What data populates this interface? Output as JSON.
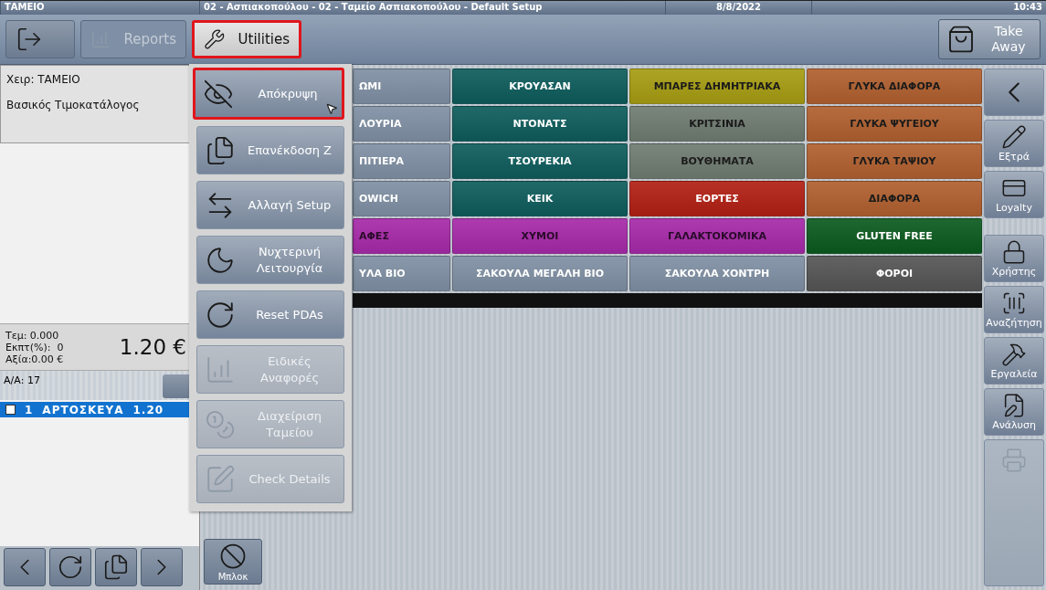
{
  "title_bar": {
    "app": "ΤΑΜΕΙΟ",
    "info": "02 - Ασπιακοπούλου - 02 - Ταμείο Ασπιακοπούλου - Default Setup",
    "date": "8/8/2022",
    "time": "10:43"
  },
  "toolbar": {
    "buttons": [
      {
        "kind": "exit",
        "disabled": false,
        "highlighted": false
      },
      {
        "kind": "reports",
        "label": "Reports",
        "disabled": true,
        "highlighted": false
      },
      {
        "kind": "utilities",
        "label": "Utilities",
        "disabled": false,
        "highlighted": true
      }
    ],
    "take_away": {
      "label": "Take Away"
    }
  },
  "left_panel": {
    "info": [
      "Χειρ: ΤΑΜΕΙΟ",
      "Βασικός Τιμοκατάλογος"
    ],
    "totals": [
      "Τεμ: 0.000",
      "Εκπτ(%):  0",
      "Αξία:0.00 €"
    ],
    "total": "1.20 €",
    "order_number": "Α/Α: 17",
    "order_lines": [
      {
        "qty": "1",
        "name": "ΑΡΤΟΣΚΕΥΑ",
        "price": "1.20",
        "selected": true,
        "checked": false
      }
    ],
    "nav": [
      {
        "kind": "prev"
      },
      {
        "kind": "refresh"
      },
      {
        "kind": "copy"
      },
      {
        "kind": "next"
      }
    ]
  },
  "utilities_menu": [
    {
      "kind": "hide",
      "label": "Απόκρυψη",
      "disabled": false,
      "highlighted": true
    },
    {
      "kind": "reissue",
      "label": "Επανέκδοση Ζ",
      "disabled": false,
      "highlighted": false
    },
    {
      "kind": "switch",
      "label": "Αλλαγή Setup",
      "disabled": false,
      "highlighted": false
    },
    {
      "kind": "night",
      "label": "Νυχτερινή Λειτουργία",
      "disabled": false,
      "highlighted": false
    },
    {
      "kind": "reset",
      "label": "Reset PDAs",
      "disabled": false,
      "highlighted": false
    },
    {
      "kind": "reports",
      "label": "Ειδικές  Αναφορές",
      "disabled": true,
      "highlighted": false
    },
    {
      "kind": "cash",
      "label": "Διαχείριση Ταμείου",
      "disabled": true,
      "highlighted": false
    },
    {
      "kind": "details",
      "label": "Check Details",
      "disabled": true,
      "highlighted": false
    }
  ],
  "categories": [
    [
      {
        "label": "ΩΜΙ",
        "color": "#7f8fa3"
      },
      {
        "label": "ΚΡΟΥΑΣΑΝ",
        "color": "#0e5c5c"
      },
      {
        "label": "ΜΠΑΡΕΣ ΔΗΜΗΤΡΙΑΚΑ",
        "color": "#a69c12"
      },
      {
        "label": "ΓΛΥΚΑ ΔΙΑΦΟΡΑ",
        "color": "#b0602f"
      }
    ],
    [
      {
        "label": "ΛΟΥΡΙΑ",
        "color": "#7f8fa3"
      },
      {
        "label": "ΝΤΟΝΑΤΣ",
        "color": "#0e5c5c"
      },
      {
        "label": "ΚΡΙΤΣΙΝΙΑ",
        "color": "#6f7b70"
      },
      {
        "label": "ΓΛΥΚΑ ΨΥΓΕΙΟΥ",
        "color": "#b0602f"
      }
    ],
    [
      {
        "label": "ΠΙΤΙΕΡΑ",
        "color": "#7f8fa3"
      },
      {
        "label": "ΤΣΟΥΡΕΚΙΑ",
        "color": "#0e5c5c"
      },
      {
        "label": "ΒΟΥΘΗΜΑΤΑ",
        "color": "#6f7b70"
      },
      {
        "label": "ΓΛΥΚΑ ΤΑΨΙΟΥ",
        "color": "#b0602f"
      }
    ],
    [
      {
        "label": "ΟWICH",
        "color": "#7f8fa3"
      },
      {
        "label": "ΚΕΙΚ",
        "color": "#0e5c5c"
      },
      {
        "label": "ΕΟΡΤΕΣ",
        "color": "#b21f14"
      },
      {
        "label": "ΔΙΑΦΟΡΑ",
        "color": "#b0602f"
      }
    ],
    [
      {
        "label": "ΑΦΕΣ",
        "color": "#a62aa8"
      },
      {
        "label": "ΧΥΜΟΙ",
        "color": "#a62aa8"
      },
      {
        "label": "ΓΑΛΑΚΤΟΚΟΜΙΚΑ",
        "color": "#a62aa8"
      },
      {
        "label": "GLUTEN FREE",
        "color": "#0c5a1e"
      }
    ],
    [
      {
        "label": "ΥΛΑ ΒΙΟ",
        "color": "#7f8fa3"
      },
      {
        "label": "ΣΑΚΟΥΛΑ ΜΕΓΑΛΗ ΒΙΟ",
        "color": "#7f8fa3"
      },
      {
        "label": "ΣΑΚΟΥΛΑ ΧΟΝΤΡΗ",
        "color": "#7f8fa3"
      },
      {
        "label": "ΦΟΡΟΙ",
        "color": "#555555"
      }
    ]
  ],
  "block_button": {
    "label": "Μπλοκ"
  },
  "side_buttons": [
    {
      "kind": "back",
      "disabled": false
    },
    {
      "kind": "extras",
      "label": "Εξτρά",
      "disabled": false
    },
    {
      "kind": "loyalty",
      "label": "Loyalty",
      "disabled": false
    },
    {
      "kind": "user",
      "label": "Χρήστης",
      "disabled": false
    },
    {
      "kind": "search",
      "label": "Αναζήτηση",
      "disabled": false
    },
    {
      "kind": "tools",
      "label": "Εργαλεία",
      "disabled": false
    },
    {
      "kind": "analysis",
      "label": "Ανάλυση",
      "disabled": false
    },
    {
      "kind": "print",
      "disabled": true
    }
  ]
}
